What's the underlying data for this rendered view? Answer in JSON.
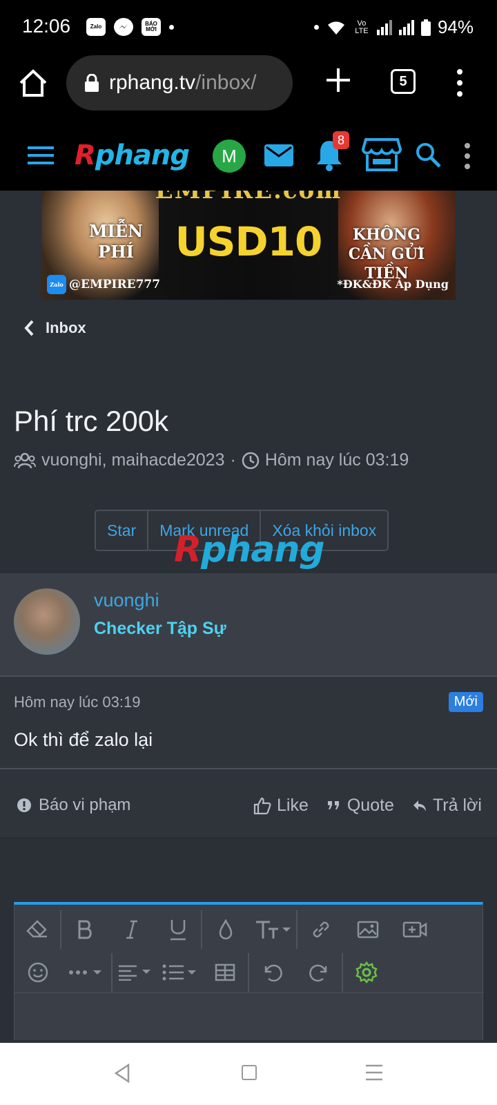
{
  "status_bar": {
    "time": "12:06",
    "app_icons": [
      "Zalo",
      "Messenger",
      "BÁO MỚI"
    ],
    "battery": "94%",
    "network_label": "Vo LTE"
  },
  "browser": {
    "url_host": "rphang.tv",
    "url_path": "/inbox/",
    "tab_count": "5"
  },
  "site_header": {
    "logo_first": "R",
    "logo_rest": "phang",
    "avatar_letter": "M",
    "notification_count": "8"
  },
  "banner": {
    "brand": "EMPIRE.com",
    "left_text": "MIỄN PHÍ",
    "amount": "USD10",
    "right_text": "KHÔNG CẦN GỬI TIỀN",
    "zalo_handle": "@EMPIRE777",
    "terms": "*ĐK&ĐK Áp Dụng",
    "zalo_chip": "Zalo"
  },
  "breadcrumb": {
    "label": "Inbox"
  },
  "conversation": {
    "title": "Phí trc 200k",
    "participants": "vuonghi, maihacde2023",
    "separator": "·",
    "timestamp": "Hôm nay lúc 03:19"
  },
  "actions": {
    "star": "Star",
    "mark_unread": "Mark unread",
    "remove": "Xóa khỏi inbox"
  },
  "watermark": {
    "first": "R",
    "rest": "phang"
  },
  "message": {
    "username": "vuonghi",
    "role": "Checker Tập Sự",
    "time": "Hôm nay lúc 03:19",
    "new_badge": "Mới",
    "text": "Ok thì để zalo lại",
    "report": "Báo vi phạm",
    "like": "Like",
    "quote": "Quote",
    "reply": "Trả lời"
  },
  "colors": {
    "accent": "#3ca7e6",
    "role": "#4dd2f0",
    "new_badge": "#2b7fe0",
    "settings_icon": "#6cc04a"
  }
}
